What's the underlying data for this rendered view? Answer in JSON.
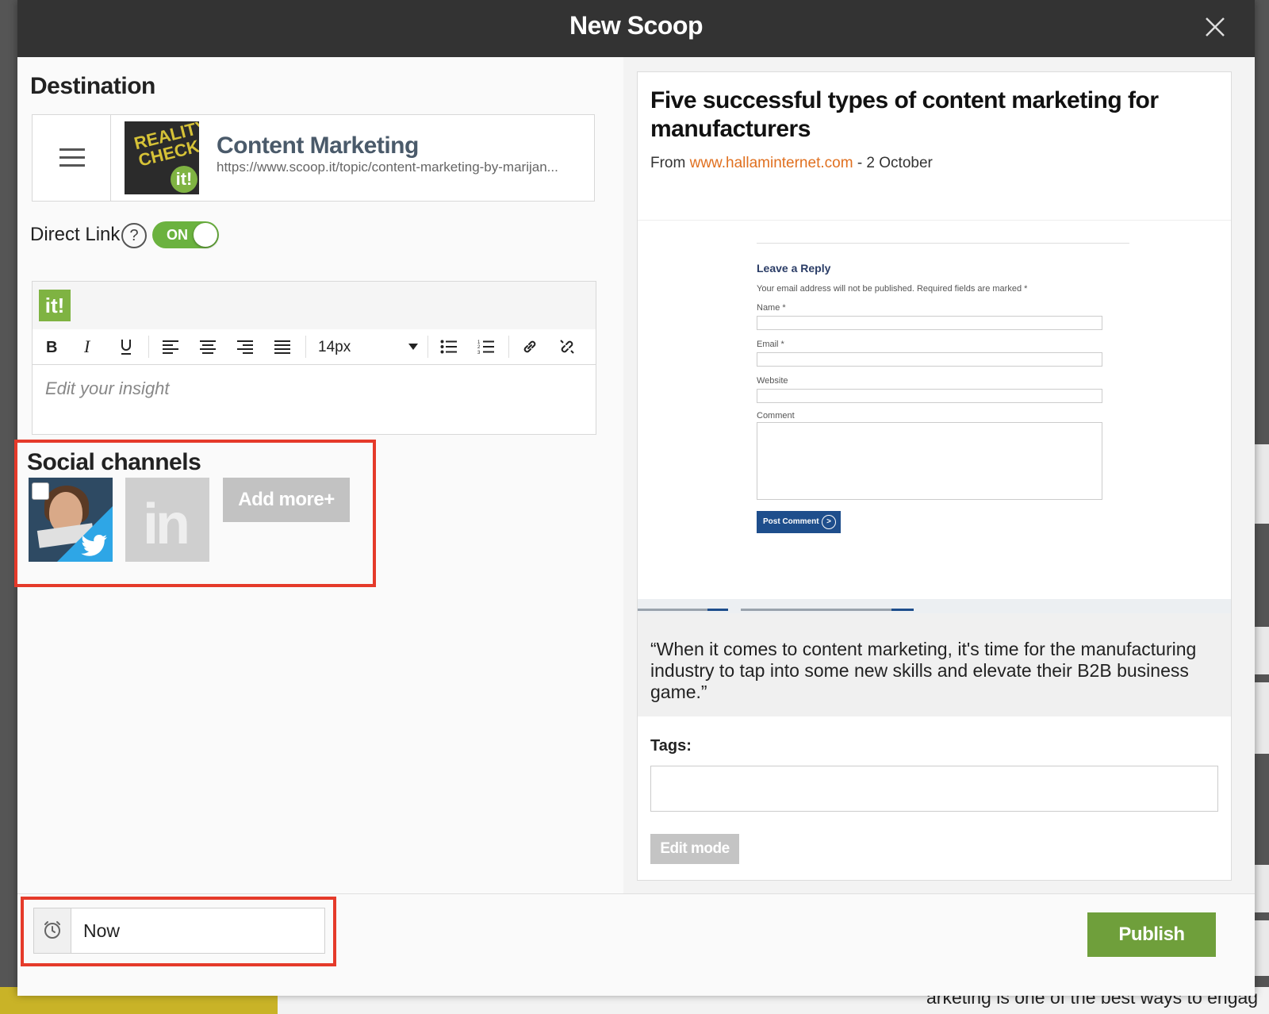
{
  "modal": {
    "title": "New Scoop"
  },
  "destination": {
    "heading": "Destination",
    "topic_name": "Content Marketing",
    "topic_url": "https://www.scoop.it/topic/content-marketing-by-marijan...",
    "thumbnail_text": "REALITY CHECK",
    "thumbnail_badge": "it!"
  },
  "direct_link": {
    "label": "Direct Link",
    "help": "?",
    "toggle_label": "ON",
    "enabled": true
  },
  "editor": {
    "logo_text": "it!",
    "font_size": "14px",
    "placeholder": "Edit your insight",
    "toolbar_icons": [
      "bold-icon",
      "italic-icon",
      "underline-icon",
      "align-left-icon",
      "align-center-icon",
      "align-right-icon",
      "align-justify-icon",
      "bullet-list-icon",
      "numbered-list-icon",
      "link-icon",
      "unlink-icon"
    ]
  },
  "social": {
    "heading": "Social channels",
    "channels": [
      {
        "network": "twitter",
        "icon": "twitter-bird-icon",
        "checked": false
      },
      {
        "network": "linkedin",
        "icon": "linkedin-icon",
        "label": "in"
      }
    ],
    "add_more_label": "Add more+"
  },
  "schedule": {
    "value": "Now",
    "icon": "clock-icon"
  },
  "publish_label": "Publish",
  "article": {
    "title": "Five successful types of content marketing for manufacturers",
    "from_prefix": "From",
    "source": "www.hallaminternet.com",
    "date": "- 2 October",
    "preview": {
      "title": "Leave a Reply",
      "note": "Your email address will not be published. Required fields are marked *",
      "fields": [
        "Name *",
        "Email *",
        "Website",
        "Comment"
      ],
      "button": "Post Comment",
      "button_icon": ">"
    },
    "quote": "“When it comes to content marketing, it's time for the manufacturing industry to tap into some new skills and elevate their B2B business game.”",
    "tags_label": "Tags:",
    "edit_mode_label": "Edit mode"
  },
  "background": {
    "bottom_text": "arketing is one of the best ways to engag"
  },
  "colors": {
    "accent_green": "#6f9f3b",
    "highlight_red": "#e53a2a",
    "link_orange": "#e07020",
    "header_dark": "#333333"
  }
}
